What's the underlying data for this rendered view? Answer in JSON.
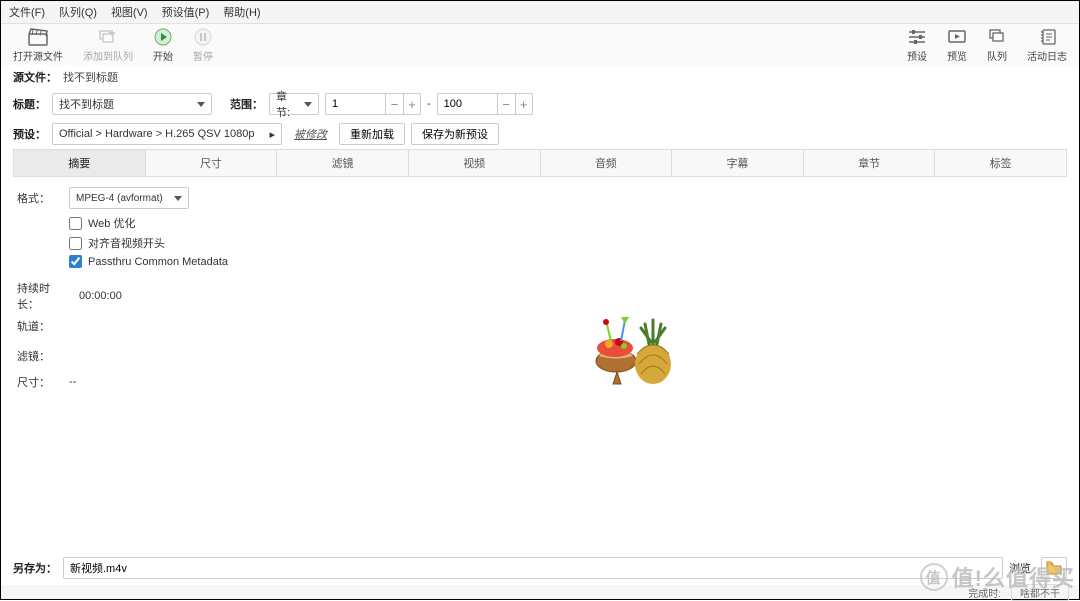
{
  "menu": {
    "file": "文件(F)",
    "queue": "队列(Q)",
    "view": "视图(V)",
    "presets": "预设值(P)",
    "help": "帮助(H)"
  },
  "toolbar_left": {
    "open": "打开源文件",
    "addqueue": "添加到队列",
    "start": "开始",
    "pause": "暂停"
  },
  "toolbar_right": {
    "presets": "预设",
    "preview": "预览",
    "queue": "队列",
    "activity": "活动日志"
  },
  "source": {
    "label": "源文件：",
    "value": "找不到标题"
  },
  "title": {
    "label": "标题：",
    "value": "找不到标题"
  },
  "range": {
    "label": "范围：",
    "mode": "章节:",
    "from": "1",
    "sep": "-",
    "to": "100"
  },
  "preset": {
    "label": "预设：",
    "value": "Official > Hardware > H.265 QSV 1080p",
    "modified": "被修改",
    "reload": "重新加载",
    "saveas": "保存为新预设"
  },
  "tabs": [
    "摘要",
    "尺寸",
    "滤镜",
    "视频",
    "音频",
    "字幕",
    "章节",
    "标签"
  ],
  "summary": {
    "format_label": "格式：",
    "format_value": "MPEG-4 (avformat)",
    "web_opt": "Web 优化",
    "align_av": "对齐音视频开头",
    "passthru": "Passthru Common Metadata",
    "duration_label": "持续时长：",
    "duration_value": "00:00:00",
    "tracks_label": "轨道：",
    "filters_label": "滤镜：",
    "size_label": "尺寸：",
    "size_value": "--"
  },
  "saveas": {
    "label": "另存为：",
    "value": "新视频.m4v",
    "browse": "浏览"
  },
  "status": {
    "done": "完成时:",
    "done_val": "啥都不干"
  },
  "watermark": "值!么值得买"
}
